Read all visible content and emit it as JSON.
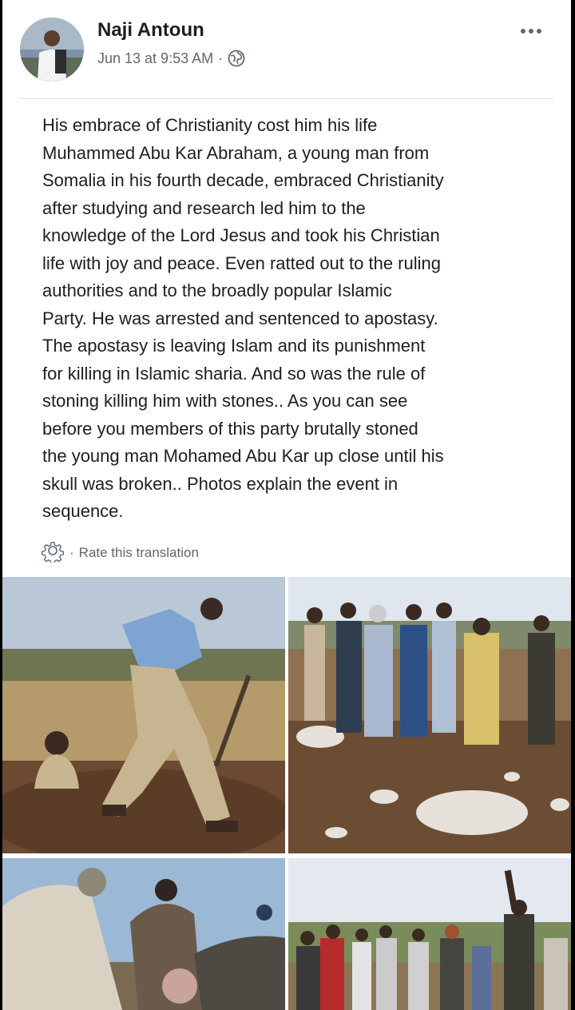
{
  "post": {
    "author": "Naji Antoun",
    "timestamp": "Jun 13 at 9:53 AM",
    "separator": "·",
    "privacy_icon": "globe-icon",
    "more_icon": "more-options-icon",
    "text": "His embrace of Christianity cost him his life\nMuhammed Abu Kar Abraham, a young man from\nSomalia in his fourth decade, embraced Christianity\nafter studying and research led him to the\nknowledge of the Lord Jesus and took his Christian\nlife with joy and peace. Even ratted out to the ruling\nauthorities and to the broadly popular Islamic\nParty. He was arrested and sentenced to apostasy.\nThe apostasy is leaving Islam and its punishment\nfor killing in Islamic sharia. And so was the rule of\nstoning killing him with stones.. As you can see\nbefore you members of this party brutally stoned\nthe young man Mohamed Abu Kar up close until his\nskull was broken.. Photos explain the event in\nsequence.",
    "translation": {
      "icon": "settings-gear-icon",
      "dot": "·",
      "label": "Rate this translation"
    }
  },
  "colors": {
    "text_primary": "#1c1e21",
    "text_secondary": "#606770",
    "background": "#ffffff",
    "outer": "#000000"
  },
  "photos": [
    {
      "name": "photo-1"
    },
    {
      "name": "photo-2"
    },
    {
      "name": "photo-3"
    },
    {
      "name": "photo-4"
    }
  ]
}
